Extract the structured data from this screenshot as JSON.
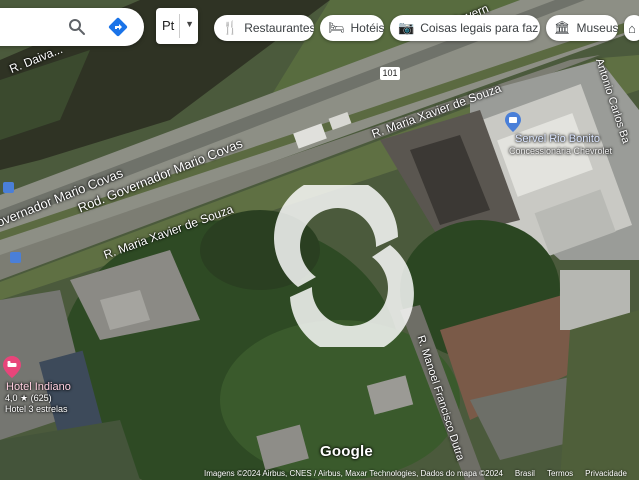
{
  "search": {
    "placeholder": ""
  },
  "language": {
    "value": "Pt"
  },
  "chips": [
    {
      "label": "Restaurantes",
      "icon": "fork-knife-icon"
    },
    {
      "label": "Hotéis",
      "icon": "bed-icon"
    },
    {
      "label": "Coisas legais para faz…",
      "icon": "camera-icon"
    },
    {
      "label": "Museus",
      "icon": "museum-icon"
    }
  ],
  "roads": {
    "daiva": "R. Daiva...",
    "rod_covas_upper": "overnador Mario Covas",
    "rod_covas_lower": "Rod. Governador Mario Covas",
    "xavier_upper": "R. Maria Xavier de Souza",
    "xavier_lower": "R. Maria Xavier de Souza",
    "manoel": "R. Manoel Francisco Dutra",
    "antonio": "Antonio Carlos Ba",
    "govern_top": "Govern",
    "shield": "101"
  },
  "places": {
    "servel_name": "Servel Rio Bonito",
    "servel_sub": "Concessionária Chevrolet",
    "hotel_name": "Hotel Indiano",
    "hotel_rating": "4,0 ★ (625)",
    "hotel_class": "Hotel 3 estrelas"
  },
  "footer": {
    "logo": "Google",
    "imagery": "Imagens ©2024 Airbus, CNES / Airbus, Maxar Technologies, Dados do mapa ©2024",
    "country": "Brasil",
    "terms": "Termos",
    "privacy": "Privacidade"
  },
  "colors": {
    "poi_blue": "#4a7fd8",
    "hotel_pink": "#e8457a"
  }
}
